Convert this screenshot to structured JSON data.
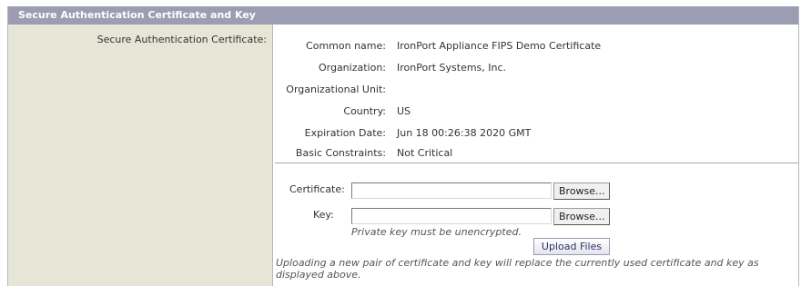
{
  "section": {
    "title": "Secure Authentication Certificate and Key",
    "left_label": "Secure Authentication Certificate:"
  },
  "certificate_info": [
    {
      "label": "Common name:",
      "value": "IronPort Appliance FIPS Demo Certificate"
    },
    {
      "label": "Organization:",
      "value": "IronPort Systems, Inc."
    },
    {
      "label": "Organizational Unit:",
      "value": ""
    },
    {
      "label": "Country:",
      "value": "US"
    },
    {
      "label": "Expiration Date:",
      "value": "Jun 18 00:26:38 2020 GMT"
    },
    {
      "label": "Basic Constraints:",
      "value": "Not Critical"
    }
  ],
  "upload_form": {
    "certificate_label": "Certificate:",
    "key_label": "Key:",
    "browse_label": "Browse...",
    "key_hint": "Private key must be unencrypted.",
    "upload_button": "Upload Files",
    "note": "Uploading a new pair of certificate and key will replace the currently used certificate and key as displayed above."
  }
}
